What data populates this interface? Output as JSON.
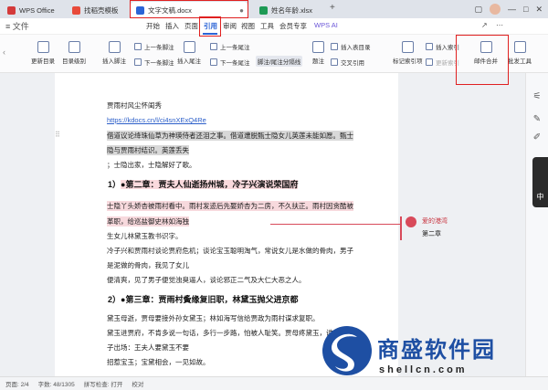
{
  "tabs": [
    {
      "label": "WPS Office",
      "color": "#d43a3a"
    },
    {
      "label": "找稻壳模板",
      "color": "#e84a3a"
    },
    {
      "label": "文字文稿.docx",
      "color": "#2b64d6"
    },
    {
      "label": "姓名年龄.xlsx",
      "color": "#1e9a55"
    }
  ],
  "menu": {
    "left_label": "≡ 文件",
    "items": [
      "开始",
      "插入",
      "页面",
      "引用",
      "审阅",
      "视图",
      "工具",
      "会员专享"
    ],
    "active": "引用",
    "wps_ai": "WPS AI"
  },
  "ribbon": {
    "update_toc": "更新目录",
    "toc_level": "目录级别",
    "insert_footnote": "插入脚注",
    "prev_footnote": "上一条脚注",
    "next_footnote": "下一条脚注",
    "insert_endnote": "插入尾注",
    "prev_endnote": "上一条尾注",
    "next_endnote": "下一条尾注",
    "footnote_divider": "脚注/尾注分隔线",
    "caption": "题注",
    "insert_table_of_figures": "插入表目录",
    "cross_reference": "交叉引用",
    "mark_index": "标记索引项",
    "insert_index": "插入索引",
    "update_index": "更新索引",
    "mail_merge": "邮件合并",
    "tools": "批发工具"
  },
  "document": {
    "lines": [
      {
        "text": "贾雨村风尘怀闺秀",
        "style": "plain"
      },
      {
        "text": "https://kdocs.cn/l/ci4snXExQ4Re",
        "style": "link"
      },
      {
        "text": "借道议论绛珠仙草为神瑛侍者还泪之事。借道遭脱甄士隐女儿英莲未能如愿。甄士",
        "style": "gray"
      },
      {
        "text": "隐与贾雨村结识。英莲丢失",
        "style": "gray"
      },
      {
        "text": "；士隐出家，士隐解好了歌。",
        "style": "plain"
      },
      {
        "text": "士隐丫头娇杏被雨村看中。雨村发迹后先娶娇杏为二房，不久扶正。雨村因贪酷被",
        "style": "pink"
      },
      {
        "text": "革职，给巡盐御史林如海独",
        "style": "pink"
      },
      {
        "text": "生女儿林黛玉教书识字。",
        "style": "plain"
      },
      {
        "text": "冷子兴和贾雨村谈论贾府危机；谈论宝玉聪明淘气，常说女儿是水做的骨肉，男子",
        "style": "plain"
      },
      {
        "text": "是泥做的骨肉，我见了女儿",
        "style": "plain"
      },
      {
        "text": "便清爽，见了男子便觉浊臭逼人，谈论邪正二气及大仁大恶之人。",
        "style": "plain"
      },
      {
        "text": "黛玉母逝，贾母要接外孙女黛玉；林如海写信给贾政为雨村谋求复职。",
        "style": "plain"
      },
      {
        "text": "黛玉进贾府，不肯多说一句话，多行一步路，怕被人耻笑。贾母疼黛玉，讲黛玉宝",
        "style": "plain"
      },
      {
        "text": "子出场：王夫人要黛玉不要",
        "style": "plain"
      },
      {
        "text": "招惹宝玉；宝黛相会，一见如故。",
        "style": "plain"
      }
    ],
    "heading1_prefix": "1）",
    "heading1": "●第二章：贾夫人仙逝扬州城，冷子兴演说荣国府",
    "heading2_prefix": "2）",
    "heading2": "●第三章：贾雨村夤缘复旧职，林黛玉抛父进京都"
  },
  "comment": {
    "author": "爱的港湾",
    "text": "第二章",
    "color": "#d84a5a"
  },
  "sidebar": {
    "dark_label": "中"
  },
  "status": {
    "page": "页面: 2/4",
    "words": "字数: 48/1305",
    "spell": "拼写检查: 打开",
    "proof": "校对"
  },
  "watermark": {
    "title": "商盛软件园",
    "url": "shellcn.com"
  }
}
